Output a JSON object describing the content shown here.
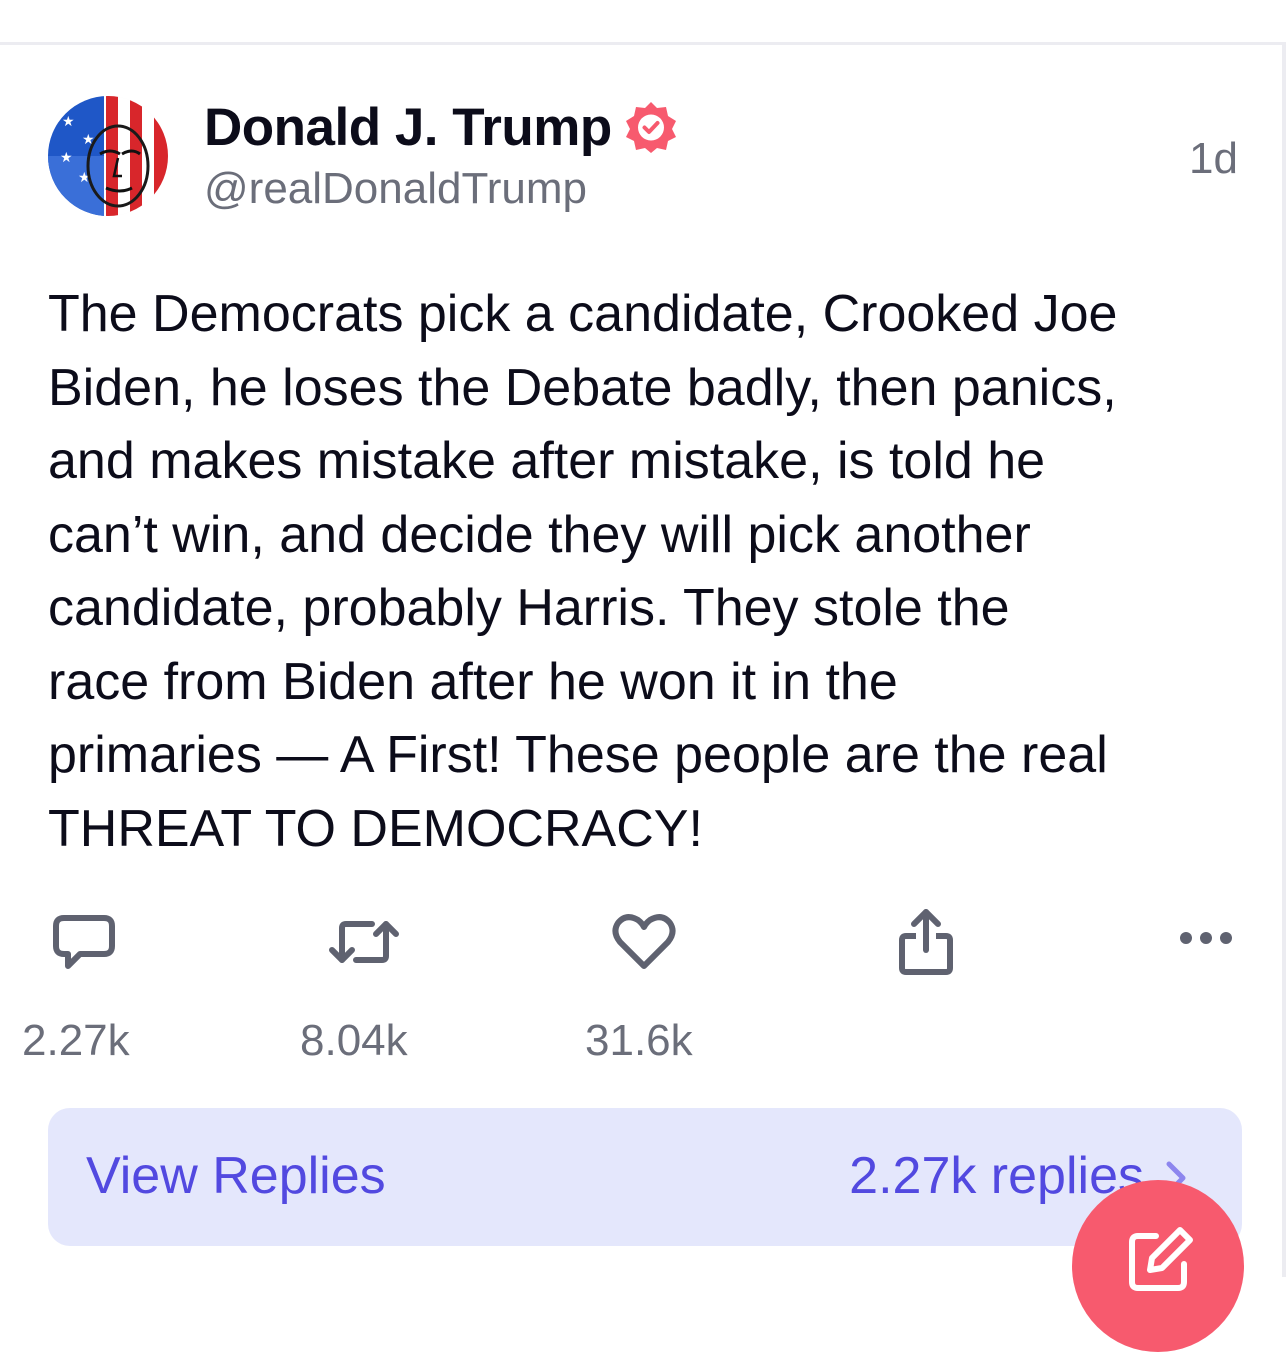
{
  "post": {
    "author": {
      "display_name": "Donald J. Trump",
      "handle": "@realDonaldTrump",
      "verified": true,
      "avatar_icon": "avatar-image"
    },
    "timestamp": "1d",
    "body_lines": [
      "The Democrats pick a candidate, Crooked Joe",
      "Biden, he loses the Debate badly, then panics,",
      "and makes mistake after mistake, is told he",
      "can’t win, and decide they will pick another",
      "candidate, probably Harris. They stole the",
      "race from Biden after he won it in the",
      "primaries — A First! These people are the real",
      "THREAT TO DEMOCRACY!"
    ],
    "actions": {
      "reply_count": "2.27k",
      "repost_count": "8.04k",
      "like_count": "31.6k",
      "icons": [
        "reply-icon",
        "repost-icon",
        "like-icon",
        "share-icon",
        "more-icon"
      ]
    }
  },
  "view_replies": {
    "label": "View Replies",
    "count_text": "2.27k replies"
  },
  "compose": {
    "icon": "compose-icon"
  },
  "colors": {
    "accent": "#5249e0",
    "accent_bg": "#e4e7fc",
    "verified_badge": "#f75a6e",
    "compose_button": "#f75a6e",
    "muted_text": "#6b6e7a",
    "primary_text": "#0c0c1a"
  }
}
